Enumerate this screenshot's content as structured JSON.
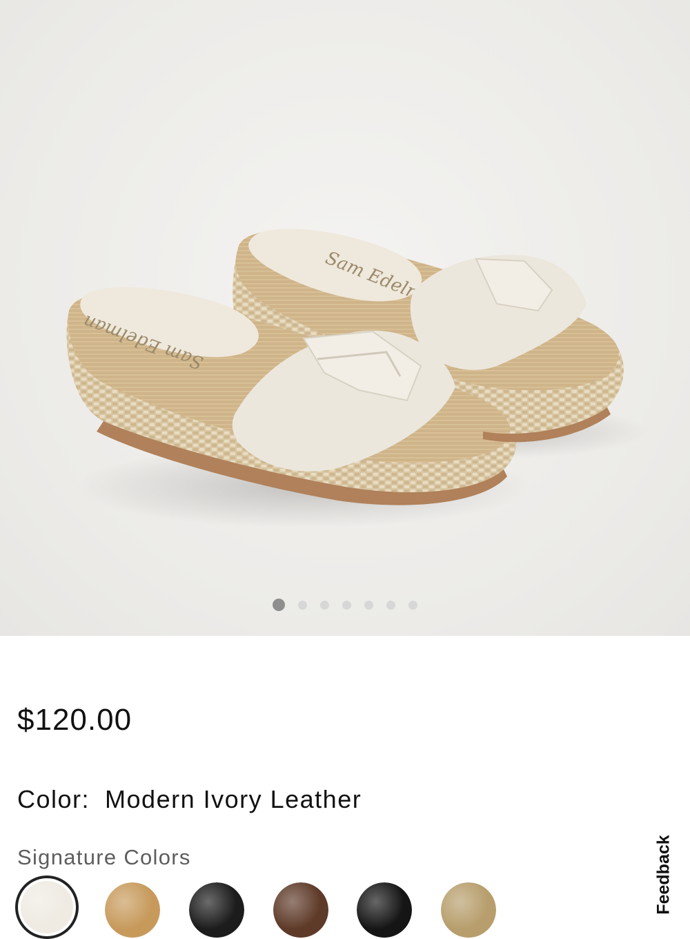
{
  "product": {
    "image_alt": "Sam Edelman raffia wedge slide sandal in Modern Ivory Leather",
    "brand_insole_text": "Sam Edelman",
    "carousel": {
      "total": 7,
      "active_index": 0
    }
  },
  "price": "$120.00",
  "color": {
    "label": "Color:",
    "value": "Modern Ivory Leather"
  },
  "signature_colors": {
    "heading": "Signature Colors",
    "swatches": [
      {
        "name": "modern-ivory-leather",
        "color": "#efebe3",
        "selected": true
      },
      {
        "name": "tan-weave",
        "color": "#c79a5c",
        "selected": false
      },
      {
        "name": "black-patent",
        "color": "#1c1c1c",
        "selected": false
      },
      {
        "name": "brown-weave",
        "color": "#5e3a28",
        "selected": false
      },
      {
        "name": "black-leather",
        "color": "#151515",
        "selected": false
      },
      {
        "name": "gold-metallic",
        "color": "#b79e6c",
        "selected": false
      }
    ]
  },
  "feedback": {
    "label": "Feedback"
  }
}
